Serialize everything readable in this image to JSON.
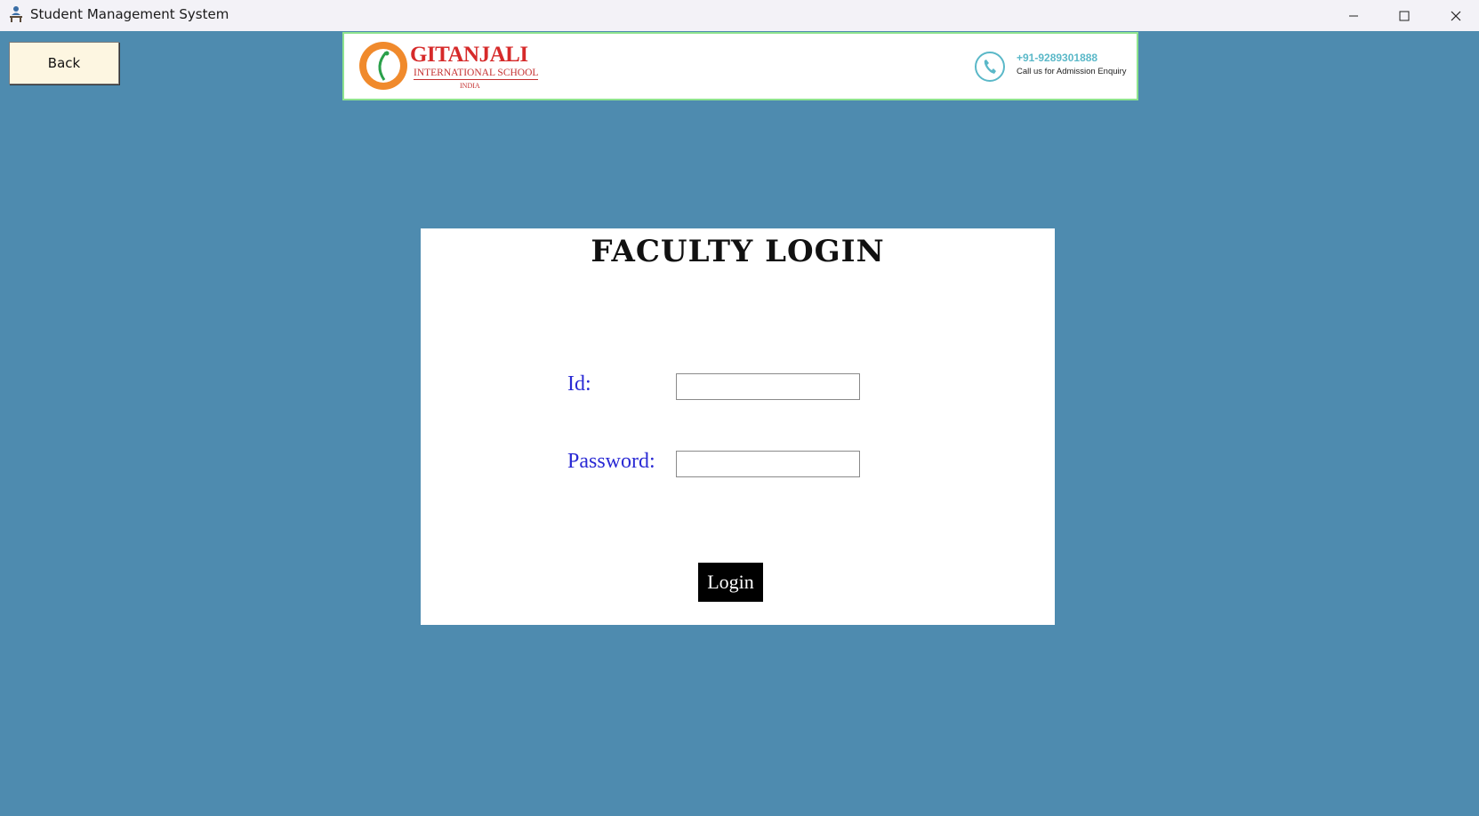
{
  "window": {
    "title": "Student Management System",
    "icon": "student-desk-icon",
    "controls": [
      "minimize-icon",
      "maximize-icon",
      "close-icon"
    ]
  },
  "nav": {
    "back_label": "Back"
  },
  "banner": {
    "school_name": "GITANJALI",
    "school_subtitle": "INTERNATIONAL SCHOOL",
    "school_country": "INDIA",
    "phone": "+91-9289301888",
    "phone_caption": "Call us for Admission Enquiry"
  },
  "login": {
    "title": "FACULTY LOGIN",
    "id_label": "Id:",
    "id_value": "",
    "password_label": "Password:",
    "password_value": "",
    "submit_label": "Login"
  },
  "colors": {
    "background": "#4e8baf",
    "label": "#2a2ad4",
    "back_button": "#fdf6e1",
    "banner_border": "#8ee38e",
    "brand_red": "#d62a2a"
  }
}
